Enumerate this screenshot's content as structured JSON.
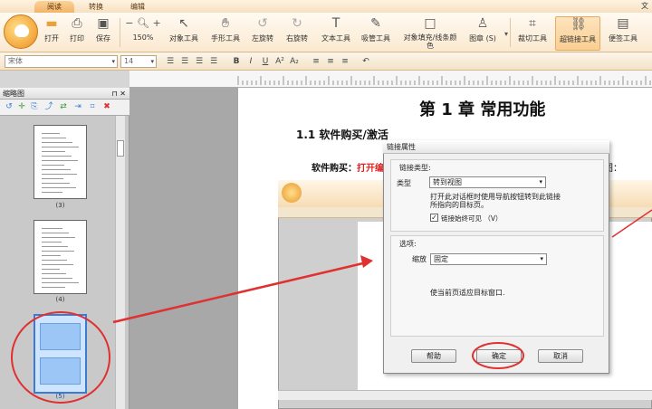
{
  "tabs": [
    "阅读",
    "转换",
    "编辑"
  ],
  "corner_text": "文",
  "ribbon": {
    "buttons": [
      {
        "label": "打开",
        "icon": "folder-icon"
      },
      {
        "label": "打印",
        "icon": "printer-icon"
      },
      {
        "label": "保存",
        "icon": "save-icon"
      },
      {
        "label": "150%",
        "icon": "zoom-icon"
      },
      {
        "label": "对象工具",
        "icon": "cursor-icon"
      },
      {
        "label": "手形工具",
        "icon": "hand-icon"
      },
      {
        "label": "左旋转",
        "icon": "rotate-left-icon"
      },
      {
        "label": "右旋转",
        "icon": "rotate-right-icon"
      },
      {
        "label": "文本工具",
        "icon": "text-icon"
      },
      {
        "label": "吸管工具",
        "icon": "eyedropper-icon"
      },
      {
        "label": "对象填充/线条颜色",
        "icon": "fill-color-icon"
      },
      {
        "label": "图章 (S)",
        "icon": "stamp-icon"
      },
      {
        "label": "裁切工具",
        "icon": "crop-icon"
      },
      {
        "label": "超链接工具",
        "icon": "link-icon"
      },
      {
        "label": "便签工具",
        "icon": "note-icon"
      }
    ],
    "zoom_minus": "−",
    "zoom_plus": "+"
  },
  "format": {
    "font": "宋体",
    "size": "14",
    "buttons": [
      "B",
      "I",
      "U",
      "A²",
      "A₂"
    ]
  },
  "left_panel": {
    "title": "缩略图",
    "pin": "⊓ ✕",
    "thumbnails": [
      "(3)",
      "(4)",
      "(5)"
    ]
  },
  "document": {
    "heading": "第 1 章  常用功能",
    "subheading": "1.1 软件购买/激活",
    "line_label": "软件购买：",
    "line_red": "打开编",
    "line_tail": "图："
  },
  "dialog": {
    "title": "链接属性",
    "group1_title": "链接类型:",
    "type_label": "类型",
    "type_value": "转到视图",
    "type_desc": "打开此对话框时使用导航按钮转到此链接所指向的目标页。",
    "checkbox_label": "链接始终可见 （V）",
    "checkbox_mark": "✓",
    "group2_title": "选项:",
    "zoom_label": "缩放",
    "zoom_value": "固定",
    "zoom_desc": "使当前页适应目标窗口.",
    "help_btn": "帮助",
    "ok_btn": "确定",
    "cancel_btn": "取消"
  },
  "highlight_color": "#e03030",
  "accent_color": "#f2b46a"
}
